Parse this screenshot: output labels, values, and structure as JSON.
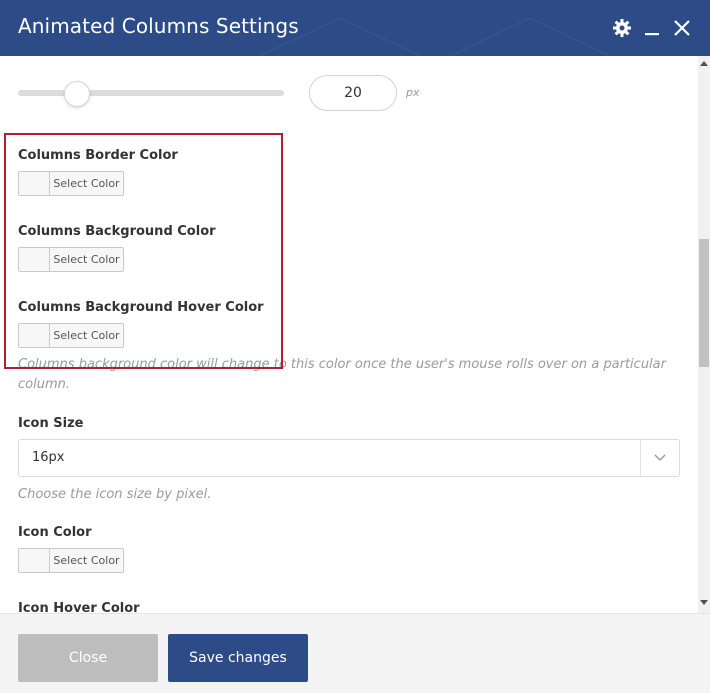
{
  "header": {
    "title": "Animated Columns Settings",
    "icons": [
      "gear-icon",
      "minimize-icon",
      "close-icon"
    ],
    "bg_color": "#2d4b86"
  },
  "slider": {
    "value": "20",
    "unit": "px"
  },
  "fields": {
    "border_color_label": "Columns Border Color",
    "bg_color_label": "Columns Background Color",
    "bg_hover_color_label": "Columns Background Hover Color",
    "bg_hover_desc_line1": "Columns background color will change to this color once the user's mouse rolls over on a particular",
    "bg_hover_desc_line2": "column.",
    "icon_size_label": "Icon Size",
    "icon_size_value": "16px",
    "icon_size_desc": "Choose the icon size by pixel.",
    "icon_color_label": "Icon Color",
    "icon_hover_color_label": "Icon Hover Color",
    "select_color": "Select Color"
  },
  "footer": {
    "close_label": "Close",
    "save_label": "Save changes"
  },
  "highlight_color": "#b11e34"
}
